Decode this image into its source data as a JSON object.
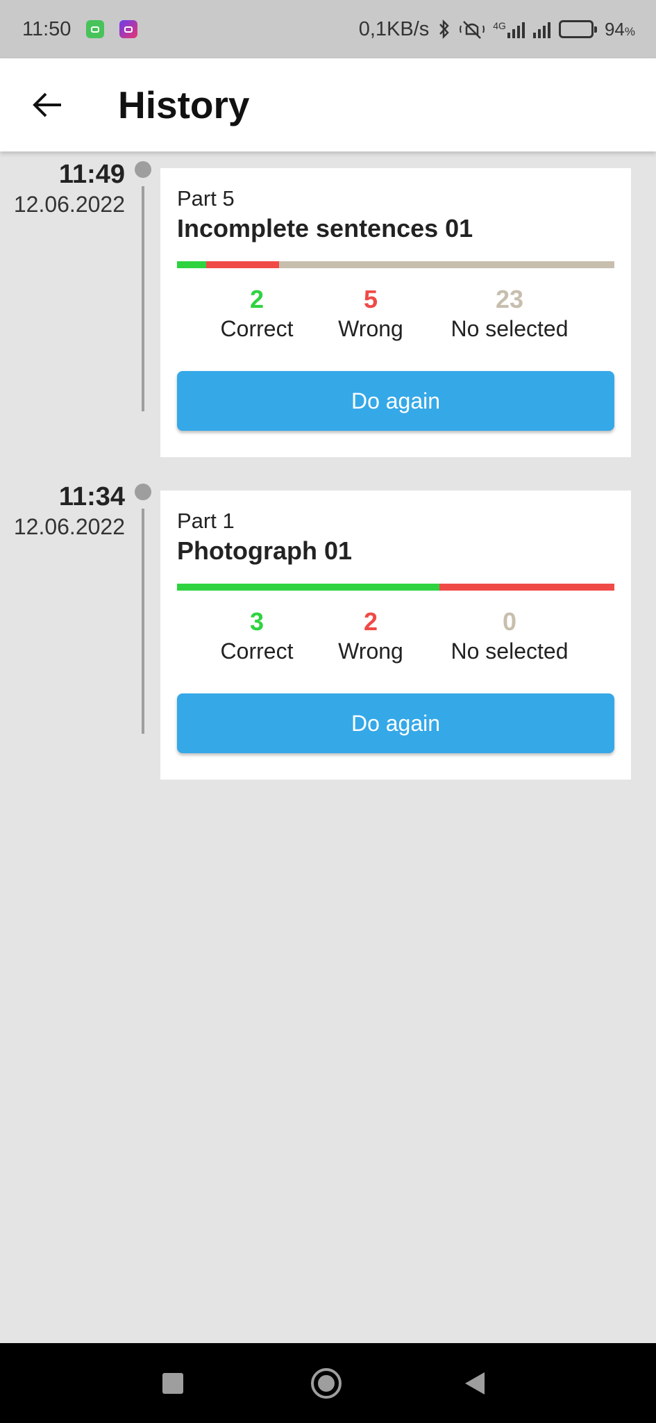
{
  "status_bar": {
    "time": "11:50",
    "network_speed": "0,1KB/s",
    "network_type": "4G",
    "battery_percent": "94",
    "battery_unit": "%",
    "icons": [
      "app-icon-green",
      "app-icon-purple",
      "bluetooth-icon",
      "mute-icon",
      "signal-icon",
      "signal-icon",
      "battery-charging-icon"
    ]
  },
  "header": {
    "title": "History",
    "back_icon": "arrow-left-icon"
  },
  "entries": [
    {
      "time": "11:49",
      "date": "12.06.2022",
      "part": "Part 5",
      "title": "Incomplete sentences 01",
      "correct": 2,
      "wrong": 5,
      "no_selected": 23,
      "correct_label": "Correct",
      "wrong_label": "Wrong",
      "no_selected_label": "No selected",
      "button_label": "Do again"
    },
    {
      "time": "11:34",
      "date": "12.06.2022",
      "part": "Part 1",
      "title": "Photograph 01",
      "correct": 3,
      "wrong": 2,
      "no_selected": 0,
      "correct_label": "Correct",
      "wrong_label": "Wrong",
      "no_selected_label": "No selected",
      "button_label": "Do again"
    }
  ],
  "colors": {
    "correct": "#2ed33f",
    "wrong": "#f04a47",
    "no_selected": "#c7beae",
    "button": "#35a8e8",
    "background": "#e4e4e4"
  },
  "nav_bar": {
    "icons": [
      "recent-apps-icon",
      "home-icon",
      "back-triangle-icon"
    ]
  }
}
